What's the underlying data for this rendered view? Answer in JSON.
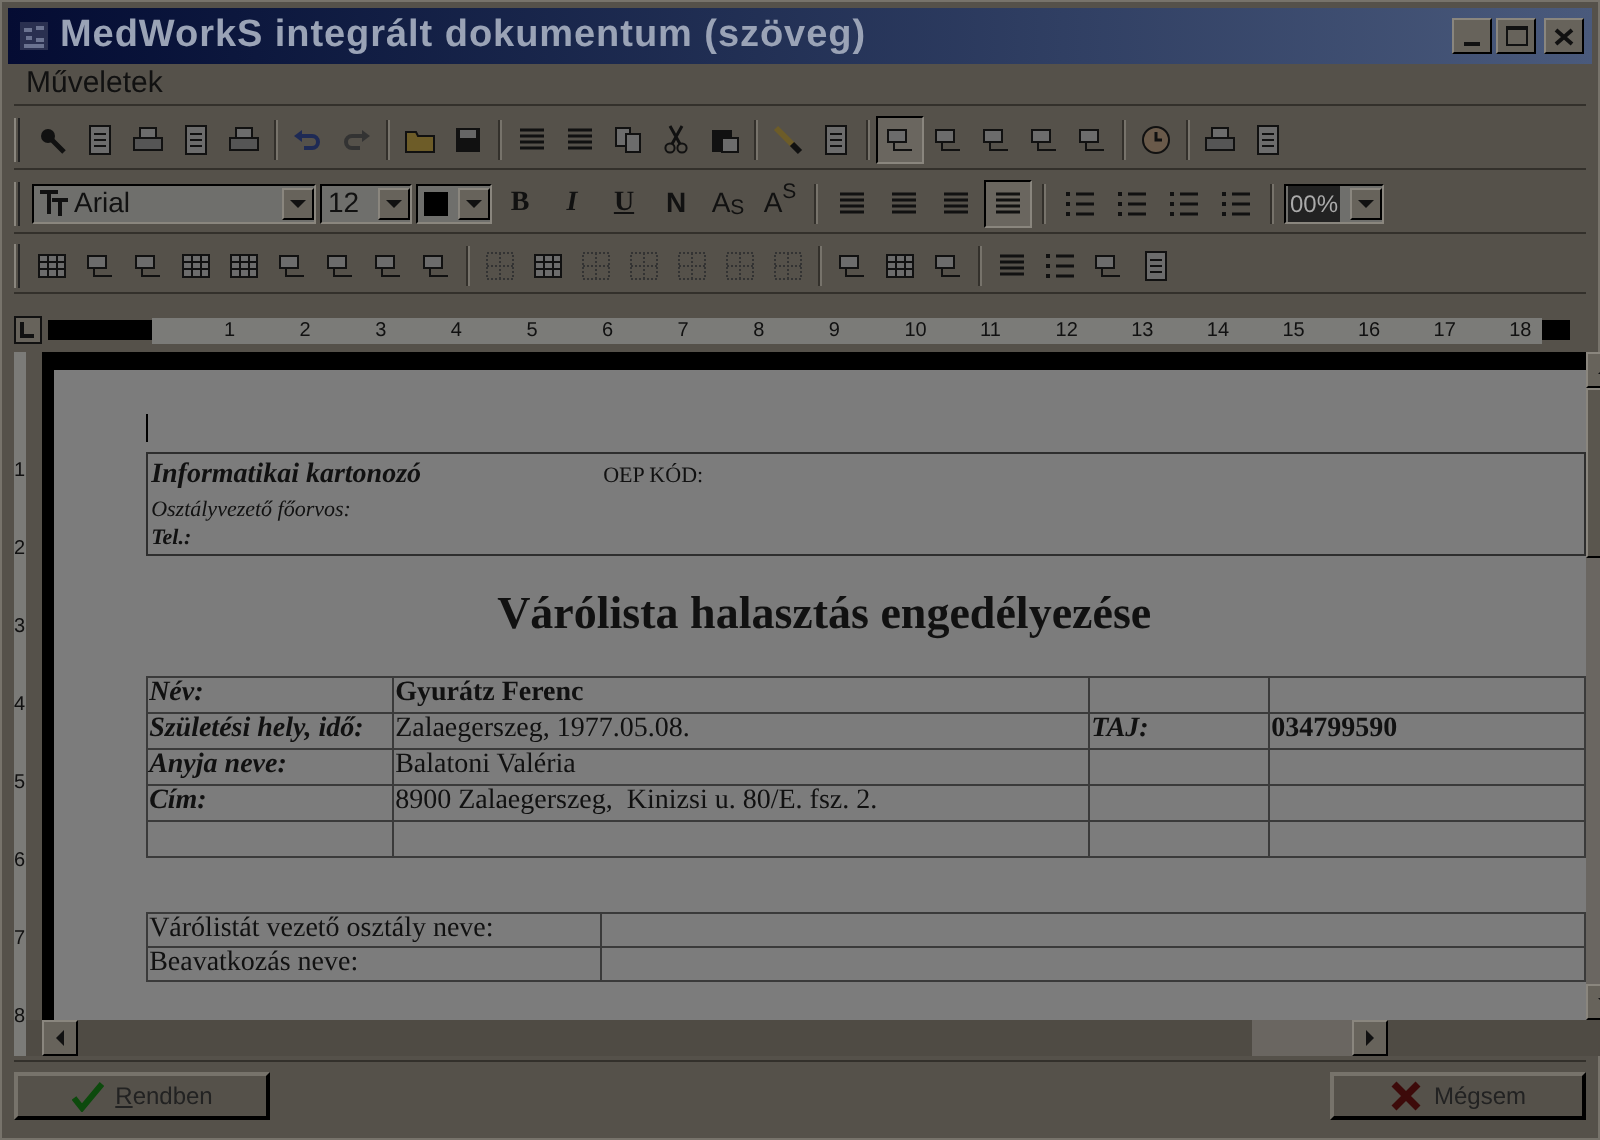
{
  "window": {
    "title": "MedWorkS integrált dokumentum (szöveg)"
  },
  "menu": [
    {
      "label": "Műveletek"
    }
  ],
  "toolbar_main": [
    {
      "pressed": false
    },
    {
      "pressed": false
    },
    {
      "pressed": false
    },
    {
      "pressed": false
    },
    {
      "pressed": false
    },
    {
      "pressed": false
    },
    {
      "pressed": false
    },
    {
      "pressed": false
    },
    {
      "pressed": false
    },
    {
      "pressed": false
    },
    {
      "pressed": false
    },
    {
      "pressed": false
    },
    {
      "pressed": false
    },
    {
      "pressed": false
    },
    {
      "pressed": false
    },
    {
      "pressed": false
    },
    {
      "pressed": true
    },
    {
      "pressed": false
    },
    {
      "pressed": false
    },
    {
      "pressed": false
    },
    {
      "pressed": false
    },
    {
      "pressed": false
    },
    {
      "pressed": false
    },
    {
      "pressed": false
    }
  ],
  "format_bar": {
    "font": "Arial",
    "size": "12",
    "styles": [
      {
        "label": "B",
        "kind": "bold"
      },
      {
        "label": "I",
        "kind": "italic"
      },
      {
        "label": "U",
        "kind": "underline"
      },
      {
        "label": "N",
        "kind": "strike"
      },
      {
        "label": "A$_{S}$",
        "kind": "sub"
      },
      {
        "label": "A$^{S}$",
        "kind": "sup"
      }
    ],
    "align": [
      {
        "pressed": false
      },
      {
        "pressed": false
      },
      {
        "pressed": false
      },
      {
        "pressed": true
      }
    ],
    "zoom": "00%"
  },
  "ruler": {
    "marks": [
      "1",
      "2",
      "3",
      "4",
      "5",
      "6",
      "7",
      "8",
      "9",
      "10",
      "11",
      "12",
      "13",
      "14",
      "15",
      "16",
      "17",
      "18"
    ],
    "side_marks": [
      "1",
      "2",
      "3",
      "4",
      "5",
      "6",
      "7",
      "8"
    ]
  },
  "document": {
    "header": {
      "org": "Informatikai kartonozó",
      "oep": "OEP KÓD:",
      "head": "Osztályvezető főorvos:",
      "tel": "Tel.:"
    },
    "title": "Várólista halasztás engedélyezése",
    "patient_rows": [
      [
        "Név:",
        "Gyurátz Ferenc",
        "",
        ""
      ],
      [
        "Születési hely, idő:",
        "Zalaegerszeg, 1977.05.08.",
        "TAJ:",
        "034799590"
      ],
      [
        "Anyja neve:",
        "Balatoni Valéria",
        "",
        ""
      ],
      [
        "Cím:",
        "8900 Zalaegerszeg,  Kinizsi u. 80/E. fsz. 2.",
        "",
        ""
      ],
      [
        "",
        "",
        "",
        ""
      ]
    ],
    "request_rows": [
      [
        "Várólistát vezető osztály neve:",
        ""
      ],
      [
        "Beavatkozás neve:",
        ""
      ]
    ]
  },
  "buttons": [
    {
      "label": "Rendben",
      "kind": "ok",
      "first_letter_underlined": true
    },
    {
      "label": "Mégsem",
      "kind": "cancel"
    }
  ]
}
